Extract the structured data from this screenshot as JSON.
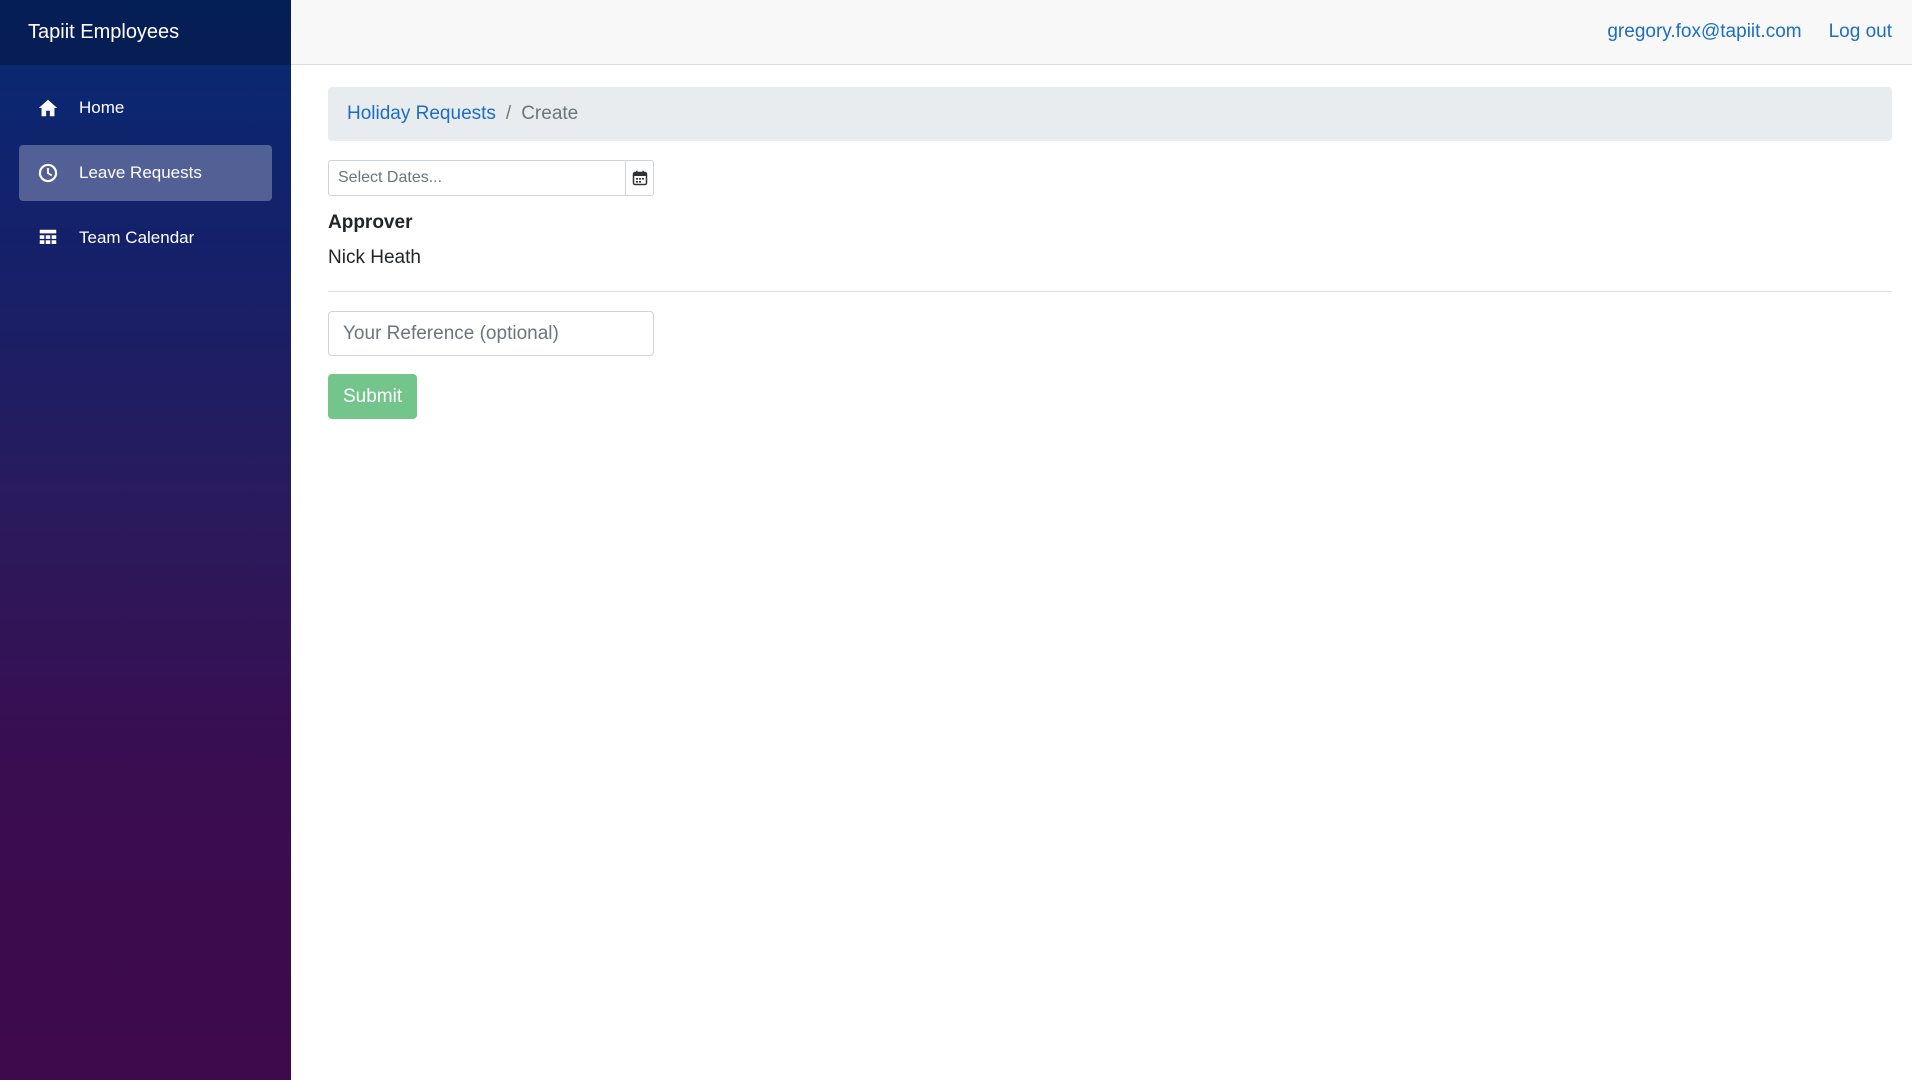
{
  "app": {
    "brand": "Tapiit Employees"
  },
  "sidebar": {
    "items": [
      {
        "label": "Home",
        "icon": "home-icon",
        "active": false
      },
      {
        "label": "Leave Requests",
        "icon": "clock-icon",
        "active": true
      },
      {
        "label": "Team Calendar",
        "icon": "calendar-grid-icon",
        "active": false
      }
    ]
  },
  "topbar": {
    "user_email": "gregory.fox@tapiit.com",
    "logout_label": "Log out"
  },
  "breadcrumb": {
    "parent": "Holiday Requests",
    "separator": "/",
    "current": "Create"
  },
  "form": {
    "dates_placeholder": "Select Dates...",
    "dates_button_icon": "calendar-icon",
    "approver_label": "Approver",
    "approver_name": "Nick Heath",
    "reference_placeholder": "Your Reference (optional)",
    "submit_label": "Submit"
  },
  "colors": {
    "accent_link": "#1b6ec2",
    "submit_button": "#73c58c",
    "sidebar_top": "#062a73",
    "sidebar_bottom": "#3e0a4c",
    "breadcrumb_bg": "#e9ecef"
  }
}
